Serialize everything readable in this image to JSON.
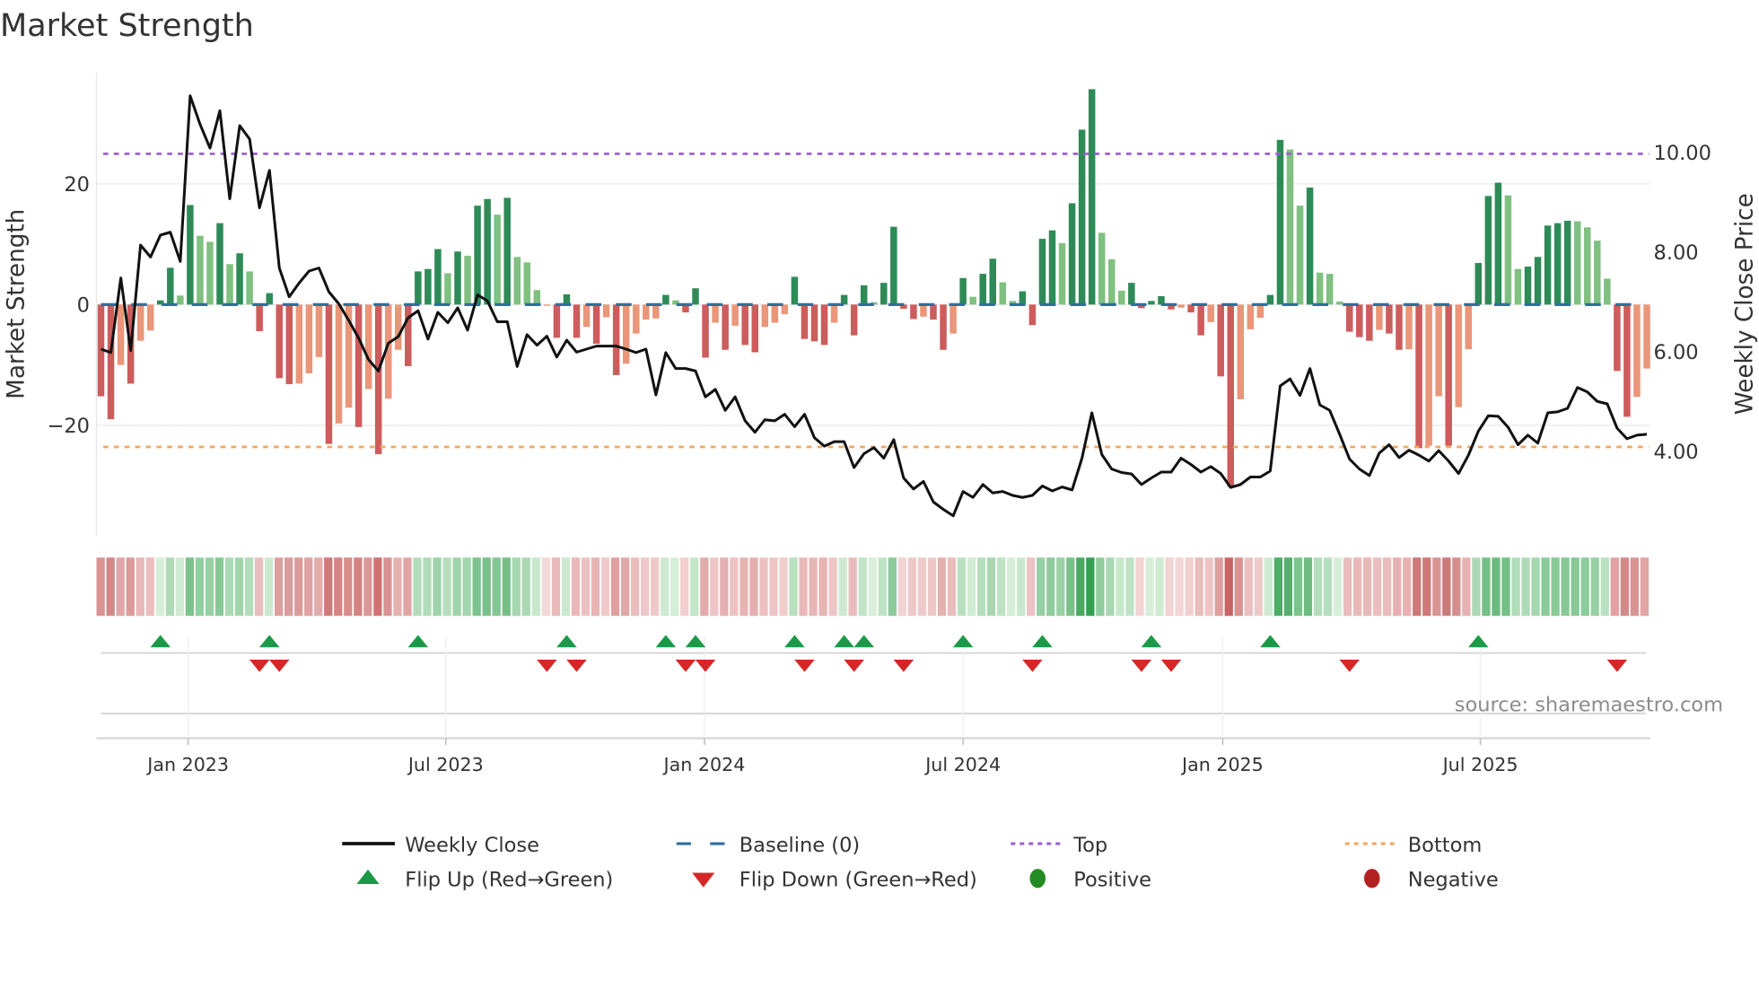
{
  "chart_data": {
    "type": "bar",
    "title": "Market Strength",
    "ylabel": "Market Strength",
    "y2label": "Weekly Close Price",
    "ylim": [
      -38.4,
      38.4
    ],
    "y2lim": [
      2.29,
      11.6
    ],
    "yticks": [
      {
        "value": 20,
        "label": "20"
      },
      {
        "value": 0,
        "label": "0"
      },
      {
        "value": -20,
        "label": "−20"
      }
    ],
    "y2ticks": [
      {
        "value": 10,
        "label": "10.00"
      },
      {
        "value": 8,
        "label": "8.00"
      },
      {
        "value": 6,
        "label": "6.00"
      },
      {
        "value": 4,
        "label": "4.00"
      }
    ],
    "xticks": [
      {
        "week_index": 8.8,
        "label": "Jan 2023"
      },
      {
        "week_index": 34.8,
        "label": "Jul 2023"
      },
      {
        "week_index": 60.9,
        "label": "Jan 2024"
      },
      {
        "week_index": 87.0,
        "label": "Jul 2024"
      },
      {
        "week_index": 113.2,
        "label": "Jan 2025"
      },
      {
        "week_index": 139.2,
        "label": "Jul 2025"
      }
    ],
    "top_level": 25,
    "bottom_level": -23.6,
    "baseline": 0,
    "strength": [
      -15.2,
      -19,
      -10,
      -13.1,
      -6,
      -4.3,
      0.7,
      6.1,
      1.5,
      16.5,
      11.4,
      10.4,
      13.5,
      6.7,
      8.5,
      5.5,
      -4.4,
      1.9,
      -12.2,
      -13.2,
      -13.1,
      -11.4,
      -8.7,
      -23.1,
      -19.7,
      -17.1,
      -20.3,
      -14,
      -24.8,
      -15.6,
      -7.5,
      -10.2,
      5.5,
      5.9,
      9.2,
      5.2,
      8.8,
      8.1,
      16.4,
      17.5,
      14.9,
      17.7,
      7.9,
      7.0,
      2.4,
      -0.2,
      -5.5,
      1.7,
      -5.5,
      -3.7,
      -6.5,
      -2.1,
      -11.7,
      -9.8,
      -4.8,
      -2.5,
      -2.3,
      1.6,
      0.7,
      -1.3,
      2.7,
      -8.8,
      -3,
      -7.5,
      -3.5,
      -6.7,
      -7.9,
      -3.7,
      -3,
      -1.6,
      4.6,
      -5.7,
      -6.1,
      -6.7,
      -3,
      1.6,
      -5.1,
      3.2,
      0.4,
      3.6,
      12.9,
      -0.7,
      -2.4,
      -2,
      -2.5,
      -7.5,
      -4.8,
      4.4,
      1.3,
      5.1,
      7.6,
      3.7,
      0.6,
      2.2,
      -3.4,
      10.9,
      12.3,
      10.2,
      16.8,
      29,
      35.7,
      11.9,
      7.5,
      2.3,
      3.6,
      -0.6,
      0.6,
      1.4,
      -0.8,
      -0.5,
      -1.3,
      -5.1,
      -2.9,
      -11.9,
      -30.2,
      -15.7,
      -4.1,
      -2.2,
      1.6,
      27.3,
      25.7,
      16.4,
      19.4,
      5.3,
      5.1,
      0.5,
      -4.5,
      -5.4,
      -6,
      -4.2,
      -4.8,
      -7.5,
      -7.4,
      -23.8,
      -23.4,
      -15.2,
      -23.4,
      -17,
      -7.4,
      6.9,
      18,
      20.2,
      18.1,
      5.9,
      6.3,
      7.9,
      13.1,
      13.5,
      13.9,
      13.8,
      12.8,
      10.6,
      4.3,
      -11,
      -18.6,
      -15.3,
      -10.6
    ],
    "shades": "RRrRrrGGgGggGgGgRGRRrrrRrrRrRrrRGGGgGgGGgGgggrRGRrRrRrrrrGgRGRrRrRRrrrGRRRrGRGgGGRRrRRrGgGGggGRGGgGGGgggGRGGRrRRrRRrrrGGggGgggRRRrRRrRrrRrrGGGggGGGGGggggRRrr",
    "weekly_close": [
      6.05,
      5.98,
      7.48,
      6.02,
      8.14,
      7.9,
      8.34,
      8.4,
      7.81,
      11.14,
      10.57,
      10.09,
      10.84,
      9.07,
      10.54,
      10.27,
      8.89,
      9.64,
      7.68,
      7.1,
      7.38,
      7.62,
      7.68,
      7.2,
      6.96,
      6.63,
      6.27,
      5.84,
      5.61,
      6.17,
      6.3,
      6.68,
      6.82,
      6.25,
      6.79,
      6.58,
      6.88,
      6.43,
      7.14,
      7.02,
      6.6,
      6.6,
      5.7,
      6.34,
      6.13,
      6.31,
      5.89,
      6.23,
      5.99,
      6.05,
      6.11,
      6.11,
      6.11,
      6.05,
      5.98,
      6.05,
      5.13,
      5.98,
      5.66,
      5.66,
      5.61,
      5.09,
      5.24,
      4.82,
      5.09,
      4.61,
      4.38,
      4.63,
      4.61,
      4.74,
      4.49,
      4.74,
      4.27,
      4.1,
      4.19,
      4.19,
      3.67,
      3.95,
      4.07,
      3.86,
      4.23,
      3.46,
      3.24,
      3.39,
      2.98,
      2.83,
      2.7,
      3.19,
      3.07,
      3.33,
      3.16,
      3.19,
      3.11,
      3.07,
      3.11,
      3.3,
      3.2,
      3.28,
      3.22,
      3.86,
      4.77,
      3.93,
      3.64,
      3.57,
      3.54,
      3.33,
      3.46,
      3.58,
      3.58,
      3.86,
      3.73,
      3.58,
      3.69,
      3.55,
      3.27,
      3.33,
      3.48,
      3.48,
      3.6,
      5.31,
      5.45,
      5.12,
      5.66,
      4.93,
      4.82,
      4.34,
      3.84,
      3.64,
      3.51,
      3.96,
      4.13,
      3.87,
      4.02,
      3.92,
      3.8,
      4.01,
      3.8,
      3.55,
      3.92,
      4.4,
      4.71,
      4.7,
      4.48,
      4.13,
      4.32,
      4.16,
      4.77,
      4.79,
      4.86,
      5.28,
      5.19,
      5.0,
      4.95,
      4.46,
      4.25,
      4.32,
      4.34
    ],
    "colors": {
      "G": "#2e8b57",
      "g": "#80c080",
      "R": "#cd5c5c",
      "r": "#e9967a",
      "line": "#111111",
      "baseline": "#2e6f9e",
      "top": "#9b5fd6",
      "bottom": "#f0a860",
      "flip_up": "#1a9a48",
      "flip_down": "#d62728",
      "positive": "#228b22",
      "negative": "#b22222"
    },
    "legend": {
      "position": "bottom",
      "items": [
        {
          "label": "Weekly Close"
        },
        {
          "label": "Baseline (0)"
        },
        {
          "label": "Top"
        },
        {
          "label": "Bottom"
        },
        {
          "label": "Flip Up (Red→Green)"
        },
        {
          "label": "Flip Down (Green→Red)"
        },
        {
          "label": "Positive"
        },
        {
          "label": "Negative"
        }
      ]
    },
    "source": "source: sharemaestro.com"
  }
}
